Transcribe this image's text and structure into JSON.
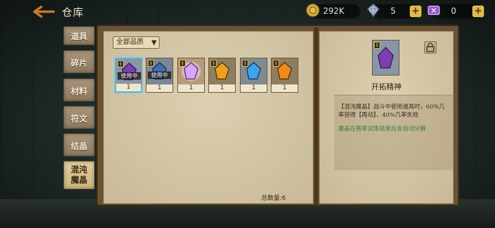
{
  "header": {
    "title": "仓库"
  },
  "currencies": [
    {
      "icon": "gold-coin-icon",
      "value": "292K"
    },
    {
      "icon": "diamond-icon",
      "value": "5"
    },
    {
      "icon": "ticket-icon",
      "value": "0"
    }
  ],
  "tabs": [
    {
      "label": "道具"
    },
    {
      "label": "碎片"
    },
    {
      "label": "材料"
    },
    {
      "label": "符文"
    },
    {
      "label": "结晶"
    },
    {
      "label": "混沌\n魔晶"
    }
  ],
  "inventory": {
    "filter_label": "全部品质",
    "items": [
      {
        "count": "1",
        "status": "使用中",
        "color": "#7a3fb0"
      },
      {
        "count": "1",
        "status": "使用中",
        "color": "#3f6fb0"
      },
      {
        "count": "1",
        "status": "",
        "color": "#d9a6ff"
      },
      {
        "count": "1",
        "status": "",
        "color": "#f0a020"
      },
      {
        "count": "1",
        "status": "",
        "color": "#3aa6f0"
      },
      {
        "count": "1",
        "status": "",
        "color": "#f08a1a"
      }
    ],
    "total_label": "总数量:6"
  },
  "detail": {
    "name": "开拓精神",
    "description": "【混沌魔晶】战斗中使用道具时，60%几率获得【再动】、40%几率失效",
    "note": "魔晶在赛季试炼结束后会自动分解"
  },
  "colors": {
    "accent_plus": "#e0b84b",
    "selection": "#4fb6e0"
  }
}
